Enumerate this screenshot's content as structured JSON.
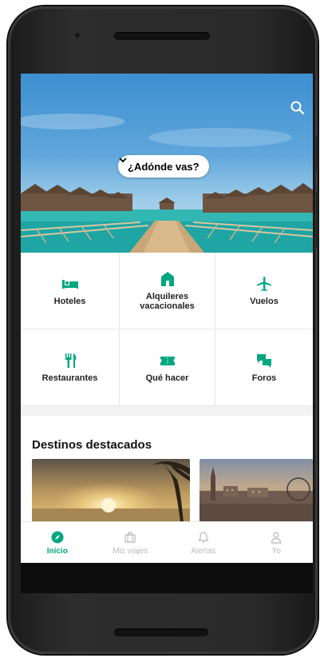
{
  "hero": {
    "destination_prompt": "¿Adónde vas?"
  },
  "categories": [
    {
      "label": "Hoteles",
      "icon": "hotel-bed-icon"
    },
    {
      "label": "Alquileres\nvacacionales",
      "icon": "vacation-rental-house-icon"
    },
    {
      "label": "Vuelos",
      "icon": "airplane-icon"
    },
    {
      "label": "Restaurantes",
      "icon": "fork-knife-icon"
    },
    {
      "label": "Qué hacer",
      "icon": "ticket-icon"
    },
    {
      "label": "Foros",
      "icon": "chat-bubbles-icon"
    }
  ],
  "featured": {
    "title": "Destinos destacados"
  },
  "bottom_nav": [
    {
      "label": "Inicio",
      "icon": "compass-icon",
      "active": true
    },
    {
      "label": "Mis viajes",
      "icon": "suitcase-icon",
      "active": false
    },
    {
      "label": "Alertas",
      "icon": "bell-icon",
      "active": false
    },
    {
      "label": "Yo",
      "icon": "user-icon",
      "active": false
    }
  ],
  "colors": {
    "accent": "#00a680",
    "inactive": "#b8b8b8",
    "phone_body": "#2a2a2a"
  }
}
